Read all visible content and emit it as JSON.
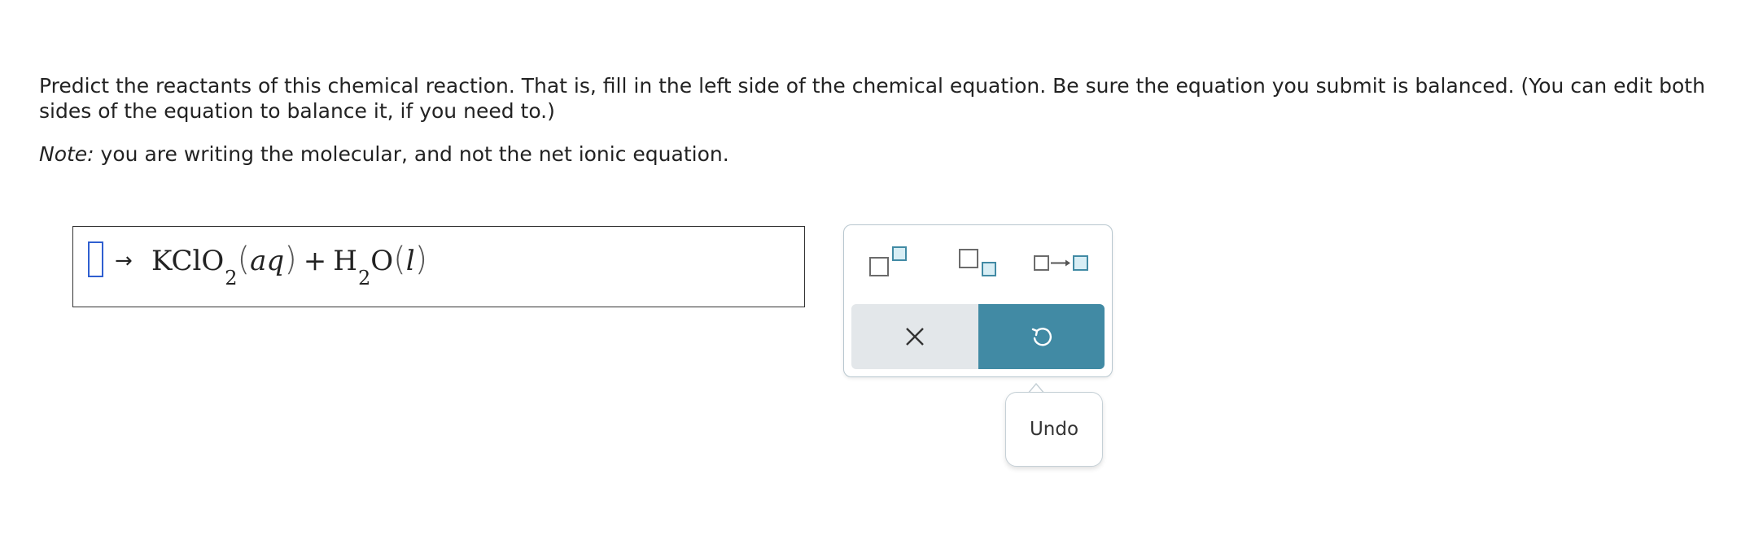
{
  "prompt": {
    "instructions": "Predict the reactants of this chemical reaction. That is, fill in the left side of the chemical equation. Be sure the equation you submit is balanced. (You can edit both sides of the equation to balance it, if you need to.)",
    "note_label": "Note:",
    "note_text": " you are writing the molecular, and not the net ionic equation."
  },
  "equation": {
    "arrow": "→",
    "product1_formula": "KClO",
    "product1_subscript": "2",
    "product1_state": "aq",
    "plus": "+",
    "product2_formula_a": "H",
    "product2_subscript": "2",
    "product2_formula_b": "O",
    "product2_state": "l",
    "paren_open": "(",
    "paren_close": ")"
  },
  "palette": {
    "tools": [
      "superscript-icon",
      "subscript-icon",
      "reaction-arrow-icon"
    ],
    "clear_icon": "close-icon",
    "undo_icon": "undo-icon",
    "accent_color": "#418aa4",
    "clear_bg": "#e3e7ea"
  },
  "tooltip": {
    "label": "Undo"
  }
}
